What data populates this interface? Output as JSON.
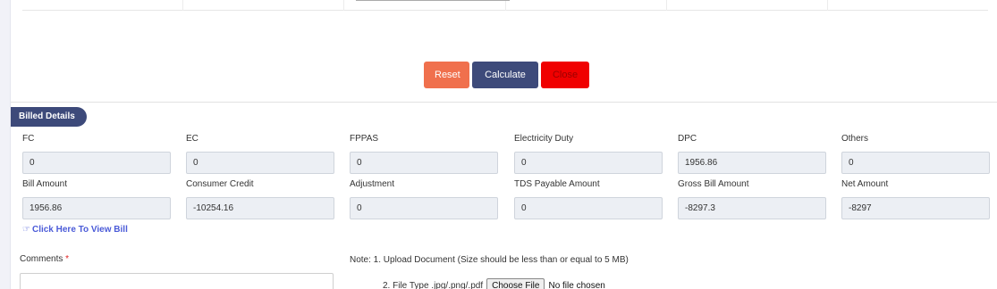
{
  "actions": {
    "reset": "Reset",
    "calculate": "Calculate",
    "close": "Close"
  },
  "section": {
    "title": "Billed Details"
  },
  "fields": [
    {
      "label": "FC",
      "value": "0"
    },
    {
      "label": "EC",
      "value": "0"
    },
    {
      "label": "FPPAS",
      "value": "0"
    },
    {
      "label": "Electricity Duty",
      "value": "0"
    },
    {
      "label": "DPC",
      "value": "1956.86"
    },
    {
      "label": "Others",
      "value": "0"
    },
    {
      "label": "Bill Amount",
      "value": "1956.86"
    },
    {
      "label": "Consumer Credit",
      "value": "-10254.16"
    },
    {
      "label": "Adjustment",
      "value": "0"
    },
    {
      "label": "TDS Payable Amount",
      "value": "0"
    },
    {
      "label": "Gross Bill Amount",
      "value": "-8297.3"
    },
    {
      "label": "Net Amount",
      "value": "-8297"
    }
  ],
  "view_bill": {
    "icon": "hand-pointer-icon",
    "label": "Click Here To View Bill"
  },
  "comments": {
    "label": "Comments",
    "required_mark": "*"
  },
  "upload": {
    "note": "Note: 1. Upload Document (Size should be less than or equal to 5 MB)",
    "file_type": "2. File Type .jpg/.png/.pdf",
    "choose_file": "Choose File",
    "status": "No file chosen"
  },
  "colors": {
    "primary": "#3d4a7a",
    "reset": "#f0704d",
    "close": "#f00000",
    "link": "#4b5bd8"
  }
}
